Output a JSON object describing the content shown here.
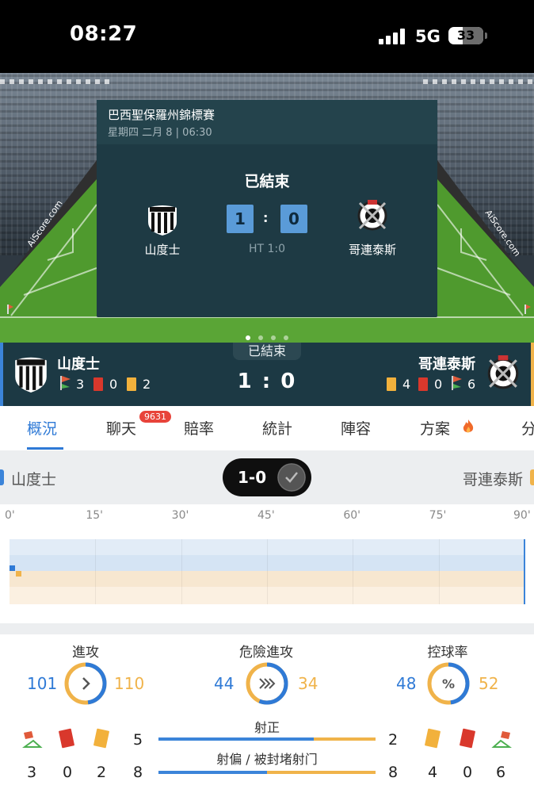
{
  "status_bar": {
    "time": "08:27",
    "network": "5G",
    "battery": "33"
  },
  "match": {
    "competition": "巴西聖保羅州錦標賽",
    "date": "星期四 二月 8 | 06:30",
    "state": "已結束",
    "home": {
      "name": "山度士",
      "score": "1"
    },
    "away": {
      "name": "哥連泰斯",
      "score": "0"
    },
    "colon": ":",
    "halftime": "HT 1:0",
    "watermark": "AiScore.com"
  },
  "carousel": {
    "page_count": 4,
    "active_page": 1
  },
  "score_bar": {
    "state": "已結束",
    "score": "1 : 0",
    "home_stats": {
      "corners": "3",
      "red": "0",
      "yellow": "2"
    },
    "away_stats": {
      "yellow": "4",
      "red": "0",
      "corners": "6"
    }
  },
  "tabs": [
    {
      "label": "概況",
      "active": true
    },
    {
      "label": "聊天",
      "badge": "9631"
    },
    {
      "label": "賠率"
    },
    {
      "label": "統計"
    },
    {
      "label": "陣容"
    },
    {
      "label": "方案"
    },
    {
      "label": "分"
    }
  ],
  "compare": {
    "home": "山度士",
    "away": "哥連泰斯",
    "result": "1-0"
  },
  "timeline": {
    "ticks": [
      "0'",
      "15'",
      "30'",
      "45'",
      "60'",
      "75'",
      "90'"
    ],
    "events": [
      {
        "team": "home",
        "minute": 0
      },
      {
        "team": "away",
        "minute": 1
      }
    ]
  },
  "stats": {
    "attack": {
      "label": "進攻",
      "home": "101",
      "away": "110"
    },
    "dangerous_attack": {
      "label": "危險進攻",
      "home": "44",
      "away": "34"
    },
    "possession": {
      "label": "控球率",
      "home": "48",
      "away": "52"
    },
    "shots_on": {
      "label": "射正",
      "home": "5",
      "away": "2"
    },
    "shots_off": {
      "label": "射偏 / 被封堵射门",
      "home": "8",
      "away": "8"
    },
    "home_counts": {
      "corners": "3",
      "red": "0",
      "yellow": "2"
    },
    "away_counts": {
      "yellow": "4",
      "red": "0",
      "corners": "6"
    }
  },
  "colors": {
    "home": "#2f7ad6",
    "away": "#f0b34a",
    "header": "#1c3944"
  }
}
